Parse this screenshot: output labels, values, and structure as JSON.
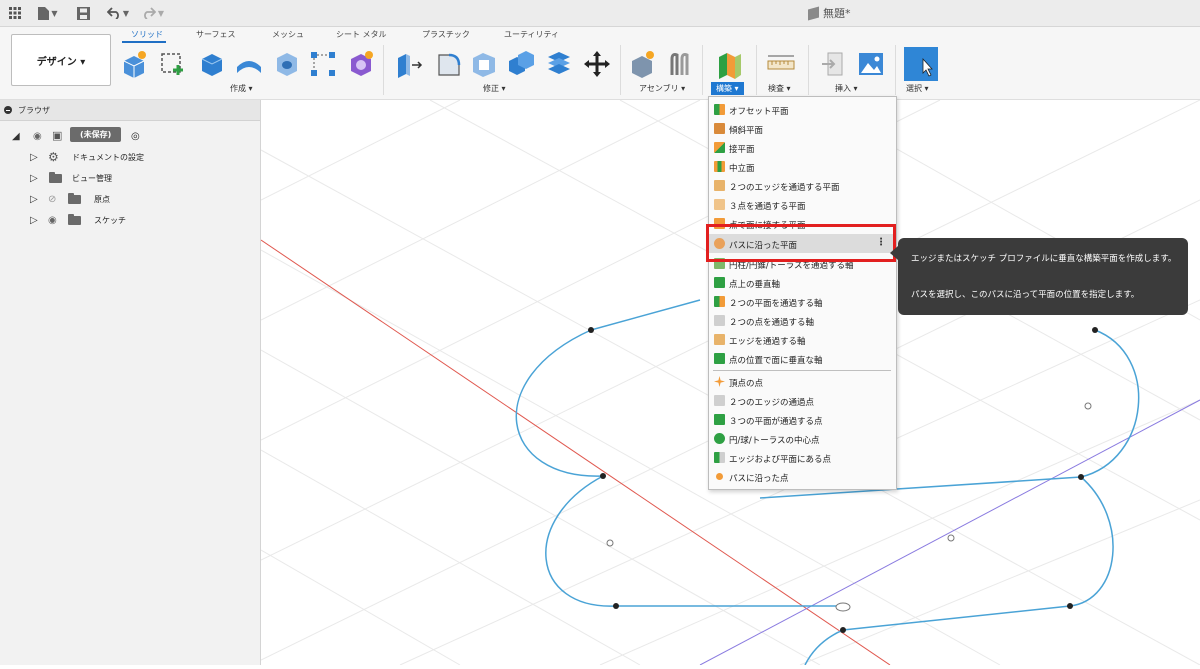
{
  "titlebar": {
    "icons": [
      "apps-grid-icon",
      "file-icon",
      "save-icon",
      "undo-icon",
      "redo-icon"
    ],
    "document_title": "無題*"
  },
  "toolbar": {
    "workspace_label": "デザイン ▾",
    "tabs": [
      "ソリッド",
      "サーフェス",
      "メッシュ",
      "シート メタル",
      "プラスチック",
      "ユーティリティ"
    ],
    "active_tab": "ソリッド",
    "groups": [
      "作成 ▾",
      "修正 ▾",
      "アセンブリ ▾",
      "構築 ▾",
      "検査 ▾",
      "挿入 ▾",
      "選択 ▾"
    ],
    "active_group": "構築 ▾",
    "accent": "#1f78d1"
  },
  "browser": {
    "title": "ブラウザ",
    "root_label": "(未保存)",
    "items": [
      "ドキュメントの設定",
      "ビュー管理",
      "原点",
      "スケッチ"
    ]
  },
  "construct_menu": {
    "items": [
      "オフセット平面",
      "傾斜平面",
      "接平面",
      "中立面",
      "２つのエッジを通過する平面",
      "３点を通過する平面",
      "点で面に接する平面",
      "パスに沿った平面",
      "円柱/円錐/トーラスを通過する軸",
      "点上の垂直軸",
      "２つの平面を通過する軸",
      "２つの点を通過する軸",
      "エッジを通過する軸",
      "点の位置で面に垂直な軸",
      "頂点の点",
      "２つのエッジの通過点",
      "３つの平面が通過する点",
      "円/球/トーラスの中心点",
      "エッジおよび平面にある点",
      "パスに沿った点"
    ],
    "highlighted_item": "パスに沿った平面",
    "highlight_border_color": "#e21f1f"
  },
  "tooltip": {
    "line1": "エッジまたはスケッチ プロファイルに垂直な構築平面を作成します。",
    "line2": "パスを選択し、このパスに沿って平面の位置を指定します。"
  },
  "canvas": {
    "sketch_color": "#4aa3d6",
    "x_axis_color": "#e0584f",
    "y_axis_color": "#8a7be0"
  }
}
